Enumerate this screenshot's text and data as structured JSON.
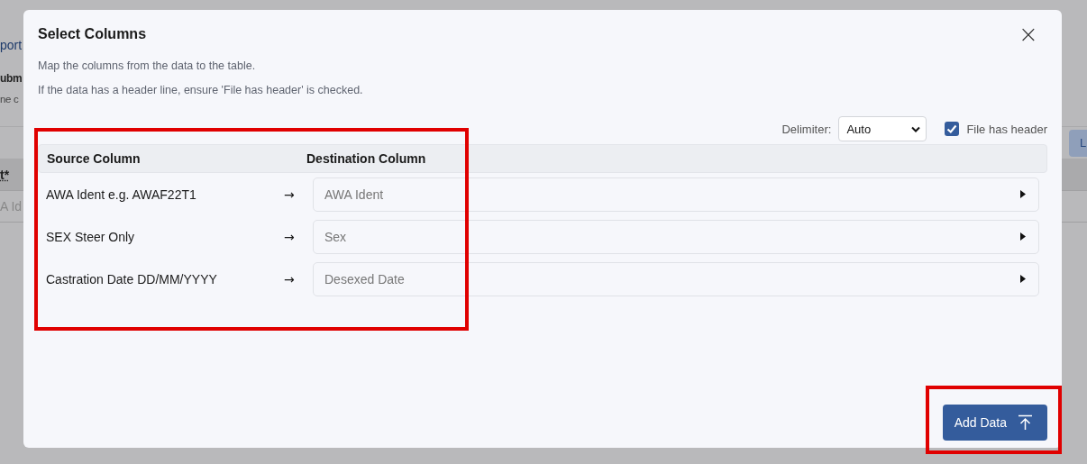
{
  "background_page": {
    "fragments": [
      {
        "kind": "link",
        "text": "port"
      },
      {
        "kind": "heading",
        "text": "ubm"
      },
      {
        "kind": "note",
        "text": "ne c"
      },
      {
        "kind": "column",
        "text": "t*"
      },
      {
        "kind": "cell",
        "text": "A Id"
      }
    ],
    "button": "L"
  },
  "dialog": {
    "title": "Select Columns",
    "close": "×",
    "descriptions": [
      "Map the columns from the data to the table.",
      "If the data has a header line, ensure 'File has header' is checked."
    ],
    "delimiter": {
      "label": "Delimiter:",
      "value": "Auto"
    },
    "file_has_header": {
      "label": "File has header",
      "checked": true
    },
    "table": {
      "columns": [
        "Source Column",
        "Destination Column"
      ],
      "highlighted": true,
      "rows": [
        {
          "source": "AWA Ident e.g. AWAF22T1",
          "arrow": "→",
          "placeholder": "AWA Ident"
        },
        {
          "source": "SEX Steer Only",
          "arrow": "→",
          "placeholder": "Sex"
        },
        {
          "source": "Castration Date DD/MM/YYYY",
          "arrow": "→",
          "placeholder": "Desexed Date"
        }
      ]
    },
    "add_button": {
      "label": "Add Data",
      "highlighted": true
    }
  }
}
